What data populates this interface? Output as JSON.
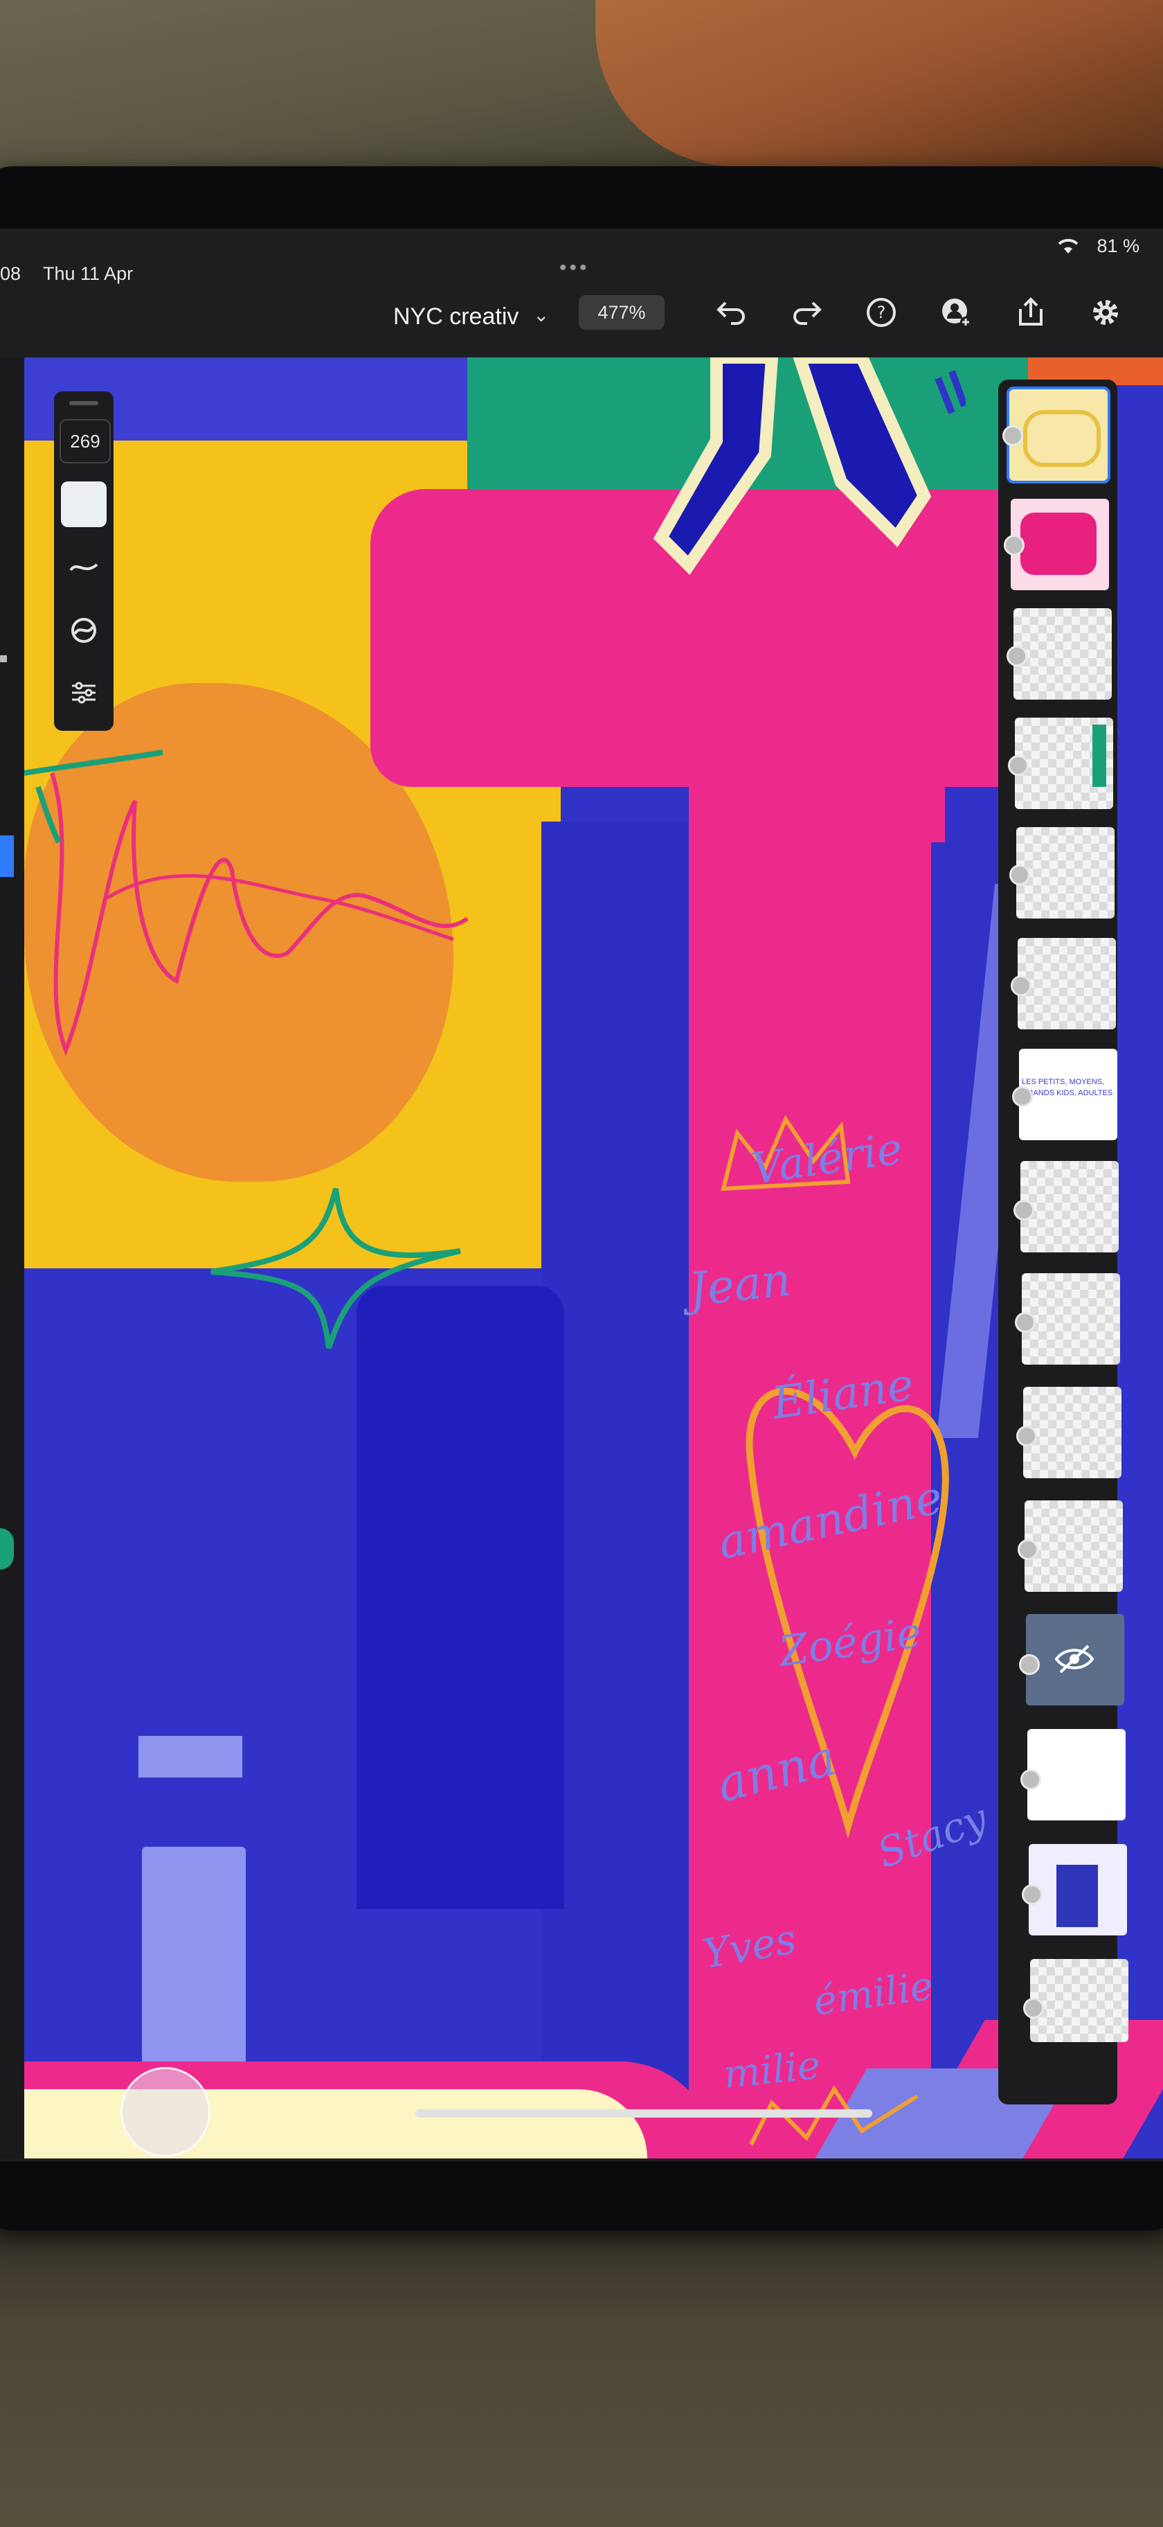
{
  "status_bar": {
    "time": "08",
    "date": "Thu 11 Apr",
    "battery": "81 %"
  },
  "toolbar": {
    "document_title": "NYC creativ",
    "zoom": "477%",
    "icons": [
      "undo-icon",
      "redo-icon",
      "help-icon",
      "invite-icon",
      "share-icon",
      "settings-icon"
    ]
  },
  "tool_panel": {
    "brush_size": "269",
    "color": "#eceff3",
    "icons": [
      "brush-icon",
      "blend-icon",
      "brush-settings-icon"
    ]
  },
  "canvas_text": {
    "layer_thumb_7_text": "LES PETITS, MOYENS, GRANDS KIDS, ADULTES",
    "names": [
      "Valérie",
      "Jean",
      "Éliane",
      "amandine",
      "Zoégie",
      "anna",
      "Stacy",
      "Yves",
      "émilie",
      "milie"
    ]
  },
  "layers": {
    "count": 15,
    "active_index": 0,
    "hidden_index": 11
  },
  "colors": {
    "canvas_blue": "#3133c8",
    "magenta": "#ec2a8c",
    "yellow": "#f5c21c",
    "green": "#1aa079",
    "accent": "#2e7bff"
  }
}
